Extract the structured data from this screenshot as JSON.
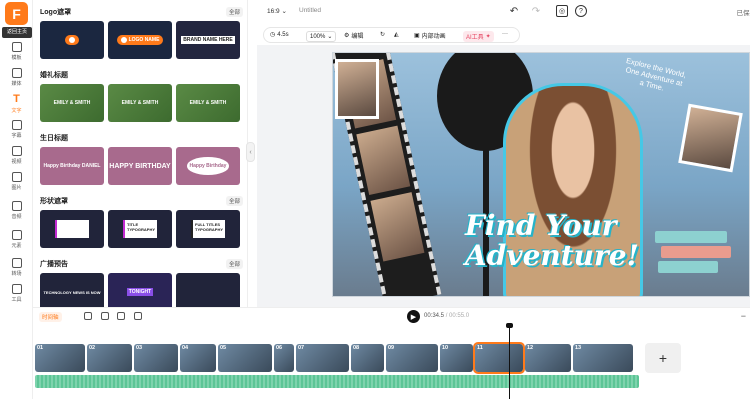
{
  "app": {
    "logo_letter": "F",
    "tooltip": "返回主页"
  },
  "rail": {
    "items": [
      {
        "label": "模板"
      },
      {
        "label": "媒体"
      },
      {
        "label": "文字",
        "active": true
      },
      {
        "label": "字幕"
      },
      {
        "label": "视频"
      },
      {
        "label": "图片"
      },
      {
        "label": "音频"
      },
      {
        "label": "元素"
      },
      {
        "label": "转场"
      },
      {
        "label": "工具"
      }
    ]
  },
  "panel": {
    "sections": [
      {
        "title": "Logo遮罩",
        "all": "全部",
        "thumbs": [
          "",
          "LOGO NAME",
          "BRAND NAME HERE"
        ]
      },
      {
        "title": "婚礼标题",
        "all": "全部",
        "thumbs": [
          "EMILY & SMITH",
          "EMILY & SMITH",
          "EMILY & SMITH"
        ]
      },
      {
        "title": "生日标题",
        "all": "全部",
        "thumbs": [
          "Happy Birthday DANIEL",
          "HAPPY BIRTHDAY",
          "Happy Birthday"
        ]
      },
      {
        "title": "形状遮罩",
        "all": "全部",
        "thumbs": [
          "",
          "TITLE TYPOGRAPHY",
          "FULL TITLES TYPOGRAPHY"
        ]
      },
      {
        "title": "广播预告",
        "all": "全部",
        "thumbs": [
          "TECHNOLOGY NEWS IS NOW",
          "TONIGHT",
          ""
        ]
      }
    ]
  },
  "topbar": {
    "ratio": "16:9",
    "doc_title": "Untitled",
    "saved": "已保存"
  },
  "toolbar": {
    "duration": "4.5s",
    "zoom": "100%",
    "edit": "编辑",
    "inner_anim": "内部动画",
    "ai_tools": "AI工具"
  },
  "canvas": {
    "headline_line1": "Find Your",
    "headline_line2": "Adventure!",
    "cloud_text": "Explore the World, One Adventure at a Time."
  },
  "playback": {
    "mode": "时间轴",
    "current": "00:34.5",
    "total": "/ 00:55.0"
  },
  "timeline": {
    "clip_numbers": [
      "01",
      "02",
      "03",
      "04",
      "05",
      "06",
      "07",
      "08",
      "09",
      "10",
      "11",
      "12",
      "13"
    ]
  }
}
